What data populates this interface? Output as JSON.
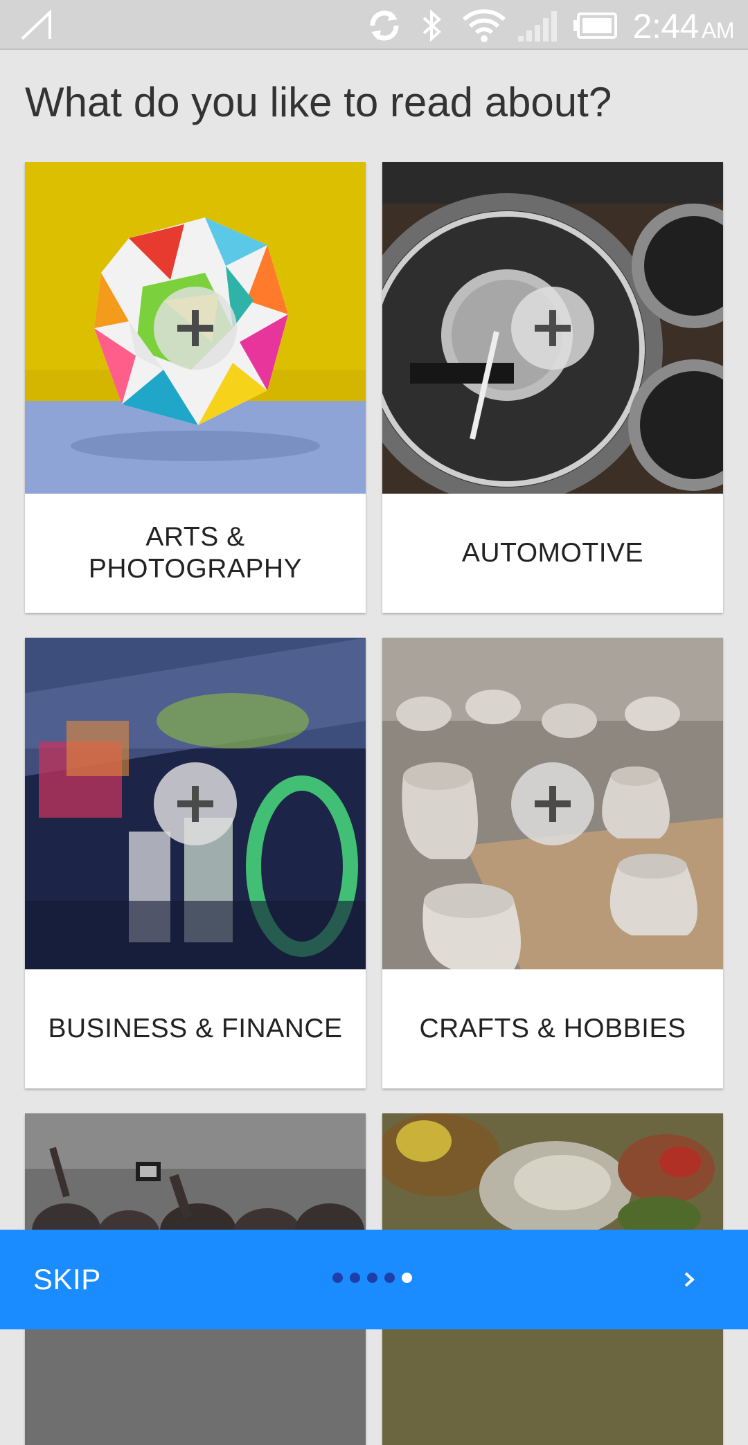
{
  "status_bar": {
    "time": "2:44",
    "ampm": "AM",
    "icons": [
      "signal-slash-icon",
      "sync-icon",
      "bluetooth-icon",
      "wifi-icon",
      "cell-signal-icon",
      "battery-icon"
    ]
  },
  "page": {
    "title": "What do you like to read about?"
  },
  "categories": [
    {
      "label": "ARTS & PHOTOGRAPHY",
      "image": "origami-sphere-photo",
      "action_icon": "plus-icon"
    },
    {
      "label": "AUTOMOTIVE",
      "image": "car-gauges-photo",
      "action_icon": "plus-icon"
    },
    {
      "label": "BUSINESS & FINANCE",
      "image": "stock-ticker-photo",
      "action_icon": "plus-icon"
    },
    {
      "label": "CRAFTS & HOBBIES",
      "image": "pottery-photo",
      "action_icon": "plus-icon"
    },
    {
      "label": "",
      "image": "concert-crowd-photo"
    },
    {
      "label": "",
      "image": "food-photo"
    }
  ],
  "bottom_bar": {
    "skip_label": "SKIP",
    "page_count": 5,
    "current_page": 5,
    "next_icon": "chevron-right-icon",
    "color": "#1a8cff"
  }
}
